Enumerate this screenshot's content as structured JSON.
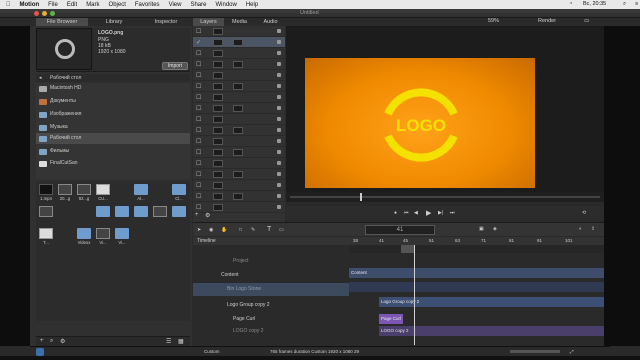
{
  "menubar": {
    "app_name": "Motion",
    "items": [
      "File",
      "Edit",
      "Mark",
      "Object",
      "Favorites",
      "View",
      "Share",
      "Window",
      "Help"
    ],
    "clock": "Вс, 20:35"
  },
  "window": {
    "title": "Untitled"
  },
  "left_tabs": [
    "File Browser",
    "Library",
    "Inspector"
  ],
  "middle_tabs": [
    "Layers",
    "Media",
    "Audio"
  ],
  "zoom": "59%",
  "render_label": "Render",
  "preview": {
    "filename": "LOGO.png",
    "type": "PNG",
    "size": "18 kB",
    "dimensions": "1920 x 1080",
    "import_label": "Import"
  },
  "path_label": "Рабочий стол",
  "sources": [
    {
      "label": "Macintosh HD"
    },
    {
      "label": "Документы"
    },
    {
      "label": "Изображения"
    },
    {
      "label": "Музыка"
    },
    {
      "label": "Рабочий стол",
      "selected": true
    },
    {
      "label": "Фильмы"
    },
    {
      "label": "FinalCutSan"
    }
  ],
  "files": [
    {
      "label": "1.mp4",
      "icon": "dark"
    },
    {
      "label": "20...g",
      "icon": "img"
    },
    {
      "label": "92...g",
      "icon": "img"
    },
    {
      "label": "CU...",
      "icon": "doc"
    },
    {
      "label": "Al...",
      "icon": "folder"
    },
    {
      "label": "Cl...",
      "icon": "folder"
    },
    {
      "label": "",
      "icon": "img"
    },
    {
      "label": "",
      "icon": "folder"
    },
    {
      "label": "",
      "icon": "folder"
    },
    {
      "label": "",
      "icon": "folder"
    },
    {
      "label": "",
      "icon": "img"
    },
    {
      "label": "",
      "icon": "folder"
    },
    {
      "label": "T...",
      "icon": "doc"
    },
    {
      "label": "Videox",
      "icon": "folder"
    },
    {
      "label": "Vi...",
      "icon": "img"
    },
    {
      "label": "Vi...",
      "icon": "folder"
    }
  ],
  "canvas": {
    "logo_text": "LOGO",
    "bg_color": "#f08a00",
    "logo_color": "#f5e100"
  },
  "timeline": {
    "title": "Timeline",
    "timecode": "41",
    "rows": [
      {
        "label": "Project"
      },
      {
        "label": "Content"
      },
      {
        "label": "Bin Logo Stone",
        "selected": true
      },
      {
        "label": "Logo Group copy 2"
      },
      {
        "label": "Page Curl"
      },
      {
        "label": "LOGO copy 2"
      }
    ],
    "clips": [
      {
        "label": "Content"
      },
      {
        "label": "Logo Group copy 2"
      },
      {
        "label": "Page Curl"
      },
      {
        "label": "LOGO copy 2"
      }
    ],
    "ruler": [
      "38",
      "41",
      "45",
      "51",
      "63",
      "71",
      "81",
      "91",
      "101"
    ]
  },
  "status": {
    "custom": "Custom",
    "info": "765 frames duration Custom 1920 x 1080 29"
  }
}
